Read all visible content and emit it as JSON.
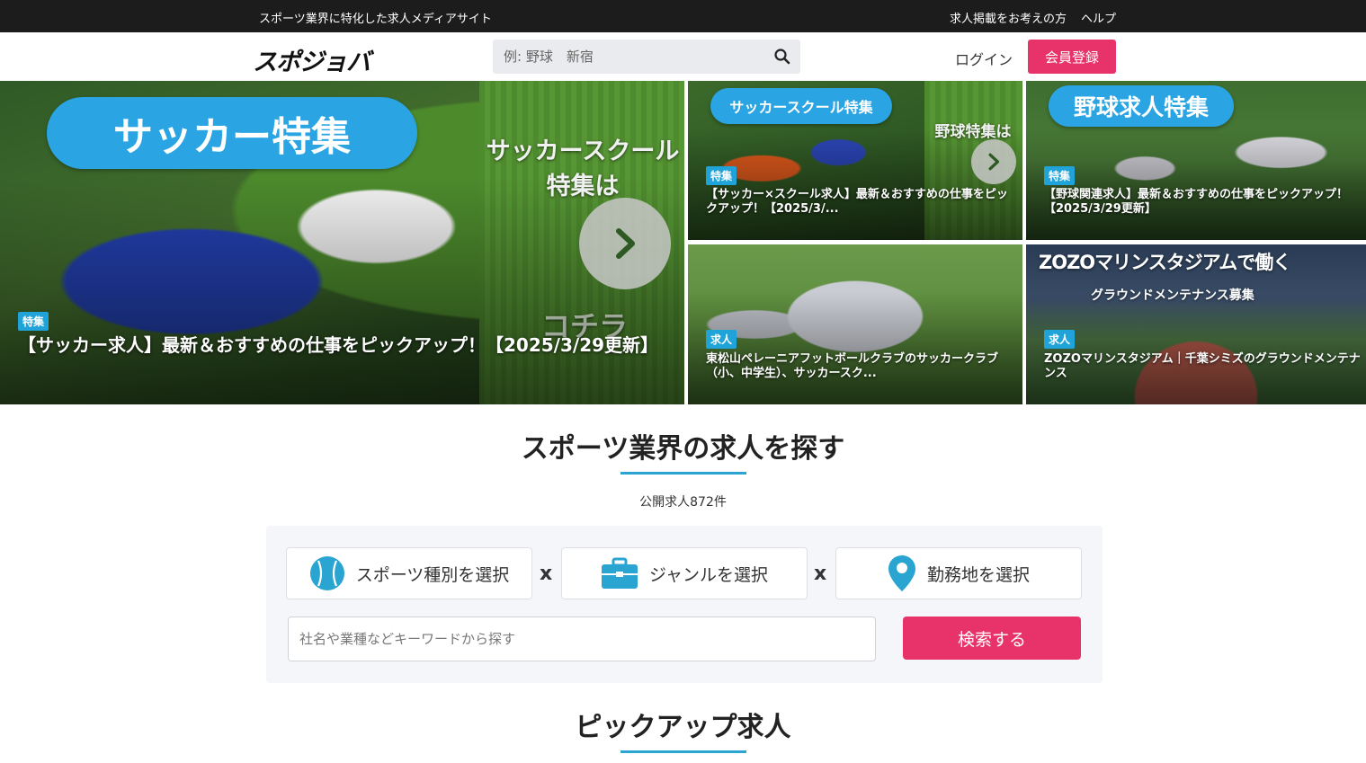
{
  "topbar": {
    "tagline": "スポーツ業界に特化した求人メディアサイト",
    "links": [
      "求人掲載をお考えの方",
      "ヘルプ"
    ]
  },
  "header": {
    "logo": "スポジョバ",
    "search_placeholder": "例: 野球　新宿",
    "login": "ログイン",
    "register": "会員登録"
  },
  "hero": {
    "main": {
      "pill": "サッカー特集",
      "side_text": "サッカースクール\n特集は",
      "bottom_text": "コチラ",
      "badge": "特集",
      "title": "【サッカー求人】最新＆おすすめの仕事をピックアップ！【2025/3/29更新】"
    },
    "tiles": [
      {
        "pill": "サッカースクール特集",
        "side_text": "野球特集は",
        "badge": "特集",
        "title": "【サッカー×スクール求人】最新＆おすすめの仕事をピックアップ！【2025/3/..."
      },
      {
        "pill": "野球求人特集",
        "badge": "特集",
        "title": "【野球関連求人】最新＆おすすめの仕事をピックアップ！【2025/3/29更新】"
      },
      {
        "badge": "求人",
        "title": "東松山ペレーニアフットボールクラブのサッカークラブ（小、中学生）、サッカースク..."
      },
      {
        "heading": "ZOZOマリンスタジアムで働く",
        "sub": "グラウンドメンテナンス募集",
        "badge": "求人",
        "title": "ZOZOマリンスタジアム｜千葉シミズのグラウンドメンテナンス"
      }
    ]
  },
  "search_section": {
    "title": "スポーツ業界の求人を探す",
    "count": "公開求人872件",
    "sport_select": "スポーツ種別を選択",
    "genre_select": "ジャンルを選択",
    "location_select": "勤務地を選択",
    "times": "x",
    "keyword_placeholder": "社名や業種などキーワードから探す",
    "search_button": "検索する"
  },
  "pickup": {
    "title": "ピックアップ求人"
  },
  "colors": {
    "accent_pink": "#e8336a",
    "accent_blue": "#2aa4d0",
    "topbar": "#1c1c1c"
  }
}
